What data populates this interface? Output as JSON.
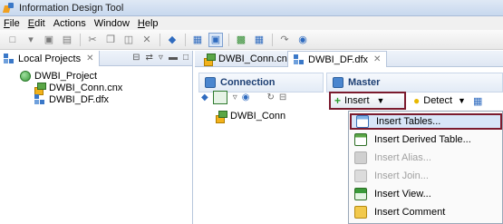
{
  "window": {
    "title": "Information Design Tool"
  },
  "menubar": [
    {
      "label": "File",
      "underline": "F",
      "rest": "ile"
    },
    {
      "label": "Edit",
      "underline": "E",
      "rest": "dit"
    },
    {
      "label": "Actions",
      "underline": "",
      "rest": "Actions"
    },
    {
      "label": "Window",
      "underline": "",
      "rest": "Window"
    },
    {
      "label": "Help",
      "underline": "H",
      "rest": "elp"
    }
  ],
  "left_panel": {
    "tab_label": "Local Projects",
    "tab_close": "✕",
    "tree": {
      "project": "DWBI_Project",
      "items": [
        "DWBI_Conn.cnx",
        "DWBI_DF.dfx"
      ]
    }
  },
  "editor_tabs": [
    {
      "label": "DWBI_Conn.cnx",
      "active": false
    },
    {
      "label": "DWBI_DF.dfx",
      "active": true,
      "close": "✕"
    }
  ],
  "connection_section": {
    "title": "Connection",
    "item": "DWBI_Conn"
  },
  "master_section": {
    "title": "Master",
    "insert_label": "Insert",
    "detect_label": "Detect"
  },
  "insert_menu": [
    {
      "label": "Insert Tables...",
      "icon": "insert-tables-icon",
      "enabled": true,
      "highlighted": true
    },
    {
      "label": "Insert Derived Table...",
      "icon": "insert-derived-table-icon",
      "enabled": true,
      "highlighted": false
    },
    {
      "label": "Insert Alias...",
      "icon": "insert-alias-icon",
      "enabled": false,
      "highlighted": false
    },
    {
      "label": "Insert Join...",
      "icon": "insert-join-icon",
      "enabled": false,
      "highlighted": false
    },
    {
      "label": "Insert View...",
      "icon": "insert-view-icon",
      "enabled": true,
      "highlighted": false
    },
    {
      "label": "Insert Comment",
      "icon": "insert-comment-icon",
      "enabled": true,
      "highlighted": false
    }
  ],
  "colors": {
    "highlight_border": "#7b1b2e",
    "selection_bg": "#d8e6f8",
    "header_text": "#1d3f73"
  }
}
